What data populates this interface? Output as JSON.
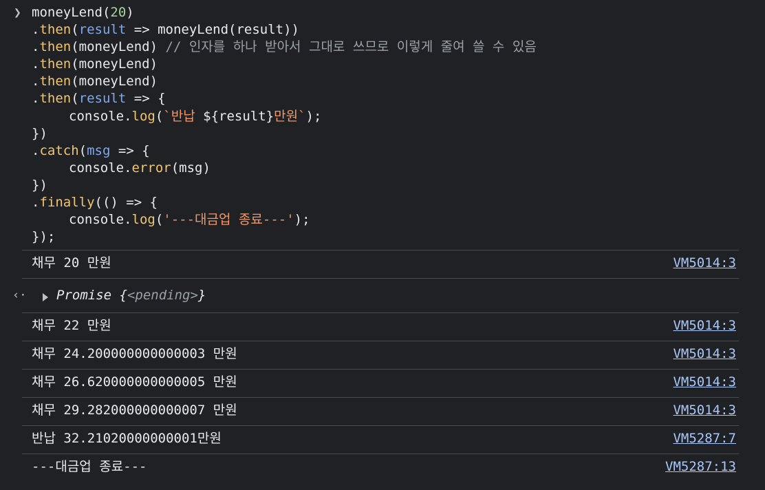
{
  "input": {
    "tokens_line1": {
      "fn": "moneyLend(",
      "arg": "20",
      "close": ")"
    },
    "line2": {
      "dot": ".",
      "method": "then",
      "open": "(",
      "param": "result",
      "rest": " => moneyLend(result))"
    },
    "line3": {
      "dot": ".",
      "method": "then",
      "rest": "(moneyLend) ",
      "comment": "// 인자를 하나 받아서 그대로 쓰므로 이렇게 줄여 쓸 수 있음"
    },
    "line4": {
      "dot": ".",
      "method": "then",
      "rest": "(moneyLend)"
    },
    "line5": {
      "dot": ".",
      "method": "then",
      "rest": "(moneyLend)"
    },
    "line6": {
      "dot": ".",
      "method": "then",
      "open": "(",
      "param": "result",
      "rest": " => {"
    },
    "line7": {
      "obj": "console.",
      "method": "log",
      "open": "(",
      "str1": "`반납 ",
      "tmpl": "${result}",
      "str2": "만원`",
      "close": ");"
    },
    "line8": {
      "text": "})"
    },
    "line9": {
      "dot": ".",
      "method": "catch",
      "open": "(",
      "param": "msg",
      "rest": " => {"
    },
    "line10": {
      "obj": "console.",
      "method": "error",
      "rest": "(msg)"
    },
    "line11": {
      "text": "})"
    },
    "line12": {
      "dot": ".",
      "method": "finally",
      "rest": "(() => {"
    },
    "line13": {
      "obj": "console.",
      "method": "log",
      "open": "(",
      "str": "'---대금업 종료---'",
      "close": ");"
    },
    "line14": {
      "text": "});"
    }
  },
  "outputs": [
    {
      "message": "채무 20 만원",
      "source": "VM5014:3"
    },
    {
      "message": "채무 22 만원",
      "source": "VM5014:3"
    },
    {
      "message": "채무 24.200000000000003 만원",
      "source": "VM5014:3"
    },
    {
      "message": "채무 26.620000000000005 만원",
      "source": "VM5014:3"
    },
    {
      "message": "채무 29.282000000000007 만원",
      "source": "VM5014:3"
    },
    {
      "message": "반납 32.21020000000001만원",
      "source": "VM5287:7"
    },
    {
      "message": "---대금업 종료---",
      "source": "VM5287:13"
    }
  ],
  "return_value": {
    "label": "Promise",
    "open": " {",
    "state": "<pending>",
    "close": "}"
  }
}
